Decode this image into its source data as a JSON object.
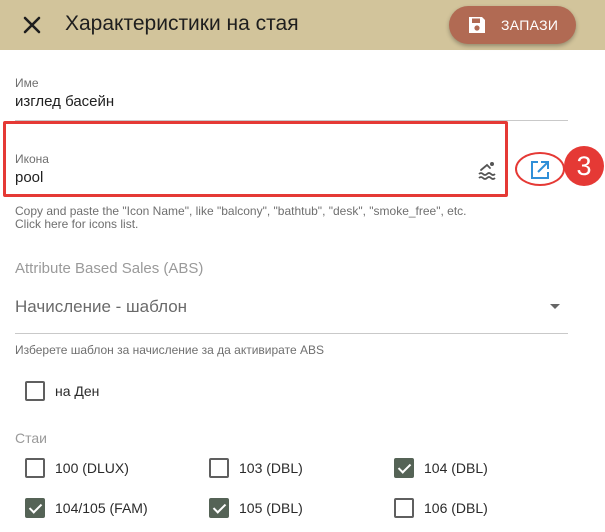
{
  "header": {
    "title": "Характеристики на стая",
    "save_label": "ЗАПАЗИ",
    "background": "#d2c49b",
    "save_color": "#b16a53"
  },
  "fields": {
    "name": {
      "label": "Име",
      "value": "изглед басейн"
    },
    "icon": {
      "label": "Икона",
      "value": "pool",
      "icon_name": "pool-icon",
      "external_icon": "open-in-new-icon"
    }
  },
  "icon_help": "Copy and paste the \"Icon Name\", like \"balcony\", \"bathtub\", \"desk\", \"smoke_free\", etc. Click here for icons list.",
  "annotation": {
    "step": "3",
    "color": "#e53935"
  },
  "abs": {
    "label": "Attribute Based Sales (ABS)",
    "select_value": "Начисление - шаблон",
    "select_help": "Изберете шаблон за начисление за да активирате ABS"
  },
  "per_day": {
    "label": "на Ден",
    "checked": false
  },
  "rooms": {
    "label": "Стаи",
    "items": [
      {
        "label": "100 (DLUX)",
        "checked": false
      },
      {
        "label": "103 (DBL)",
        "checked": false
      },
      {
        "label": "104 (DBL)",
        "checked": true
      },
      {
        "label": "104/105 (FAM)",
        "checked": true
      },
      {
        "label": "105 (DBL)",
        "checked": true
      },
      {
        "label": "106 (DBL)",
        "checked": false
      }
    ]
  },
  "checkbox_checked_color": "#556356"
}
